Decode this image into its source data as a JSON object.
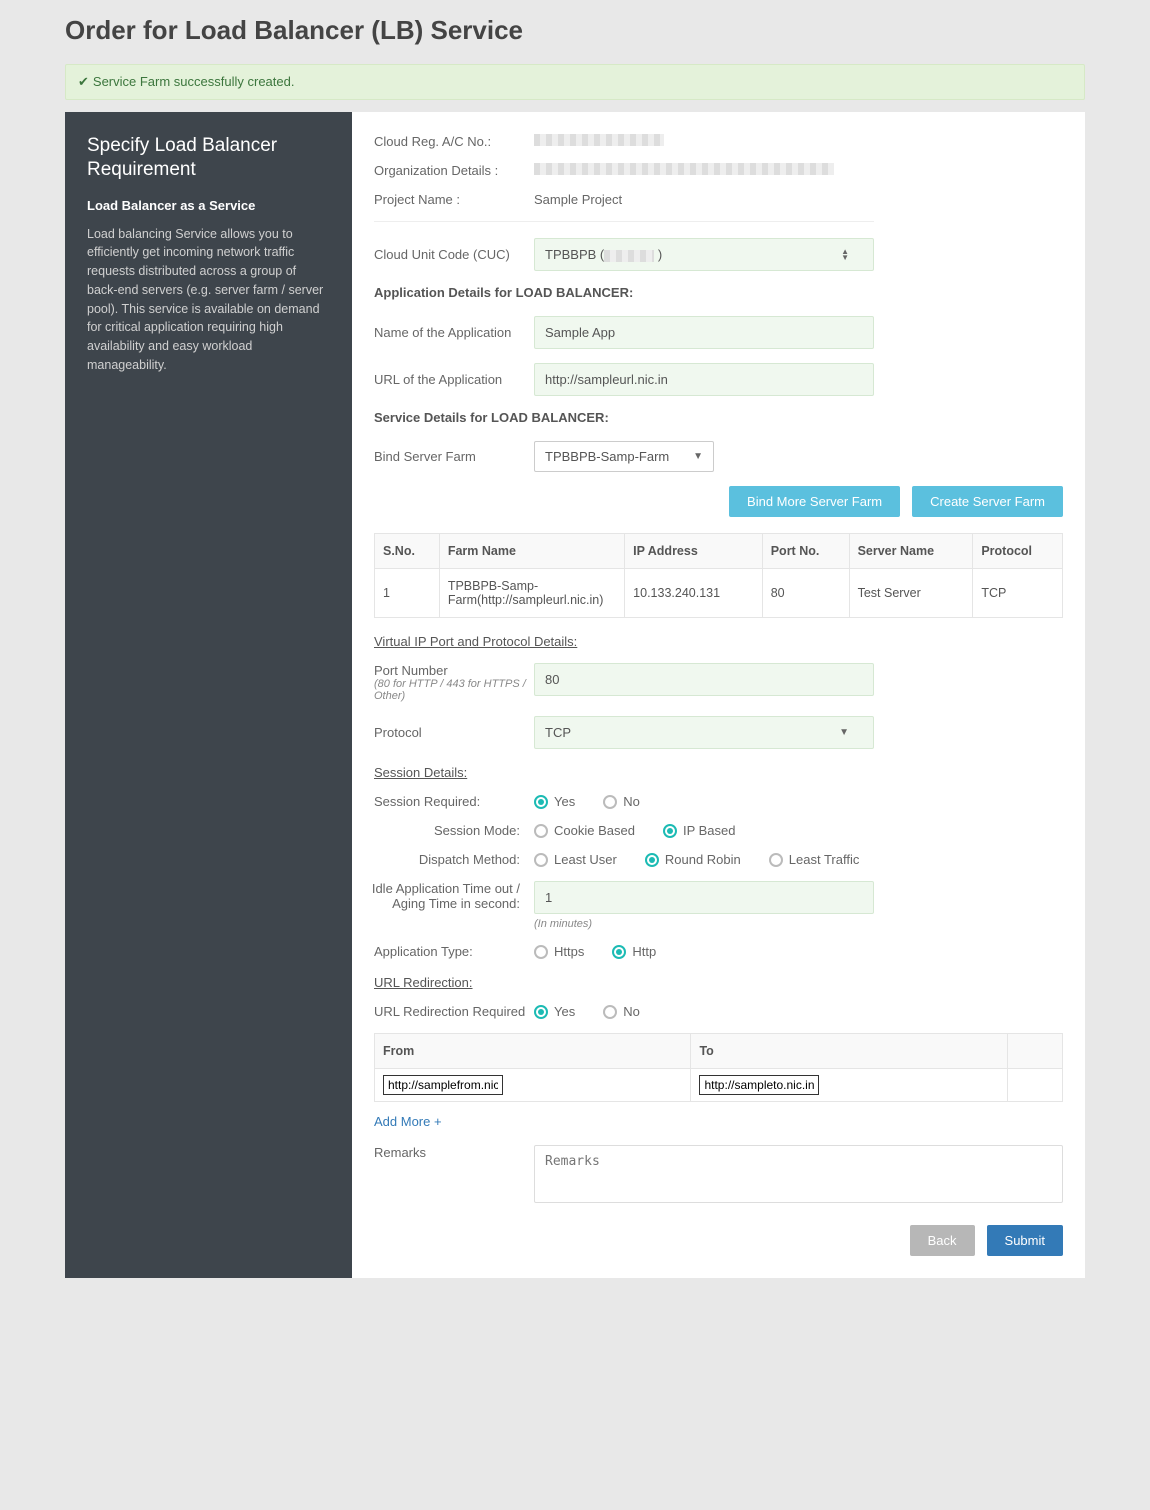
{
  "page_title": "Order for Load Balancer (LB) Service",
  "alert": "Service Farm successfully created.",
  "sidebar": {
    "title": "Specify Load Balancer Requirement",
    "subtitle": "Load Balancer as a Service",
    "desc": "Load balancing Service allows you to efficiently get incoming network traffic requests distributed across a group of back-end servers (e.g. server farm / server pool). This service is available on demand for critical application requiring high availability and easy workload manageability."
  },
  "info": {
    "cloud_reg_label": "Cloud Reg. A/C No.:",
    "org_label": "Organization Details :",
    "project_label": "Project Name :",
    "project_value": "Sample Project",
    "cuc_label": "Cloud Unit Code (CUC)",
    "cuc_value": "TPBBPB    ("
  },
  "app": {
    "section": "Application Details for LOAD BALANCER:",
    "name_label": "Name of the Application",
    "name_value": "Sample App",
    "url_label": "URL of the Application",
    "url_value": "http://sampleurl.nic.in"
  },
  "service": {
    "section": "Service Details for LOAD BALANCER:",
    "bind_label": "Bind Server Farm",
    "bind_value": "TPBBPB-Samp-Farm",
    "btn_bind": "Bind More Server Farm",
    "btn_create": "Create Server Farm"
  },
  "table": {
    "headers": [
      "S.No.",
      "Farm Name",
      "IP Address",
      "Port No.",
      "Server Name",
      "Protocol"
    ],
    "row": {
      "sno": "1",
      "farm": "TPBBPB-Samp-Farm(http://sampleurl.nic.in)",
      "ip": "10.133.240.131",
      "port": "80",
      "server": "Test Server",
      "protocol": "TCP"
    }
  },
  "vip": {
    "section": "Virtual IP Port and Protocol Details:",
    "port_label": "Port Number",
    "port_hint": "(80 for HTTP / 443 for HTTPS / Other)",
    "port_value": "80",
    "proto_label": "Protocol",
    "proto_value": "TCP"
  },
  "session": {
    "section": "Session Details:",
    "req_label": "Session Required:",
    "yes": "Yes",
    "no": "No",
    "mode_label": "Session Mode:",
    "cookie": "Cookie Based",
    "ip": "IP Based",
    "dispatch_label": "Dispatch Method:",
    "least_user": "Least User",
    "rr": "Round Robin",
    "least_traffic": "Least Traffic",
    "idle_label": "Idle Application Time out / Aging Time in second:",
    "idle_value": "1",
    "idle_hint": "(In minutes)",
    "apptype_label": "Application Type:",
    "https": "Https",
    "http": "Http"
  },
  "redir": {
    "section": "URL Redirection:",
    "req_label": "URL Redirection Required",
    "from": "From",
    "to": "To",
    "from_val": "http://samplefrom.nic.in",
    "to_val": "http://sampleto.nic.in",
    "add_more": "Add More +"
  },
  "remarks": {
    "label": "Remarks",
    "placeholder": "Remarks"
  },
  "footer": {
    "back": "Back",
    "submit": "Submit"
  }
}
